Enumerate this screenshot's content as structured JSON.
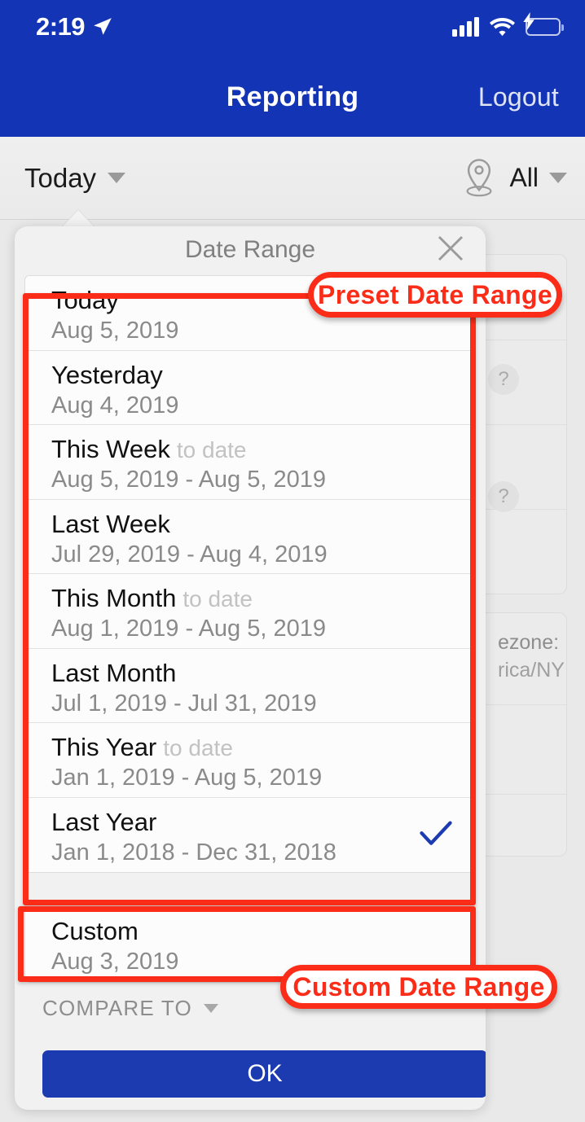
{
  "status_bar": {
    "time": "2:19",
    "location_icon": "location-arrow-icon",
    "signal_icon": "cellular-signal-icon",
    "wifi_icon": "wifi-icon",
    "battery_icon": "battery-charging-icon"
  },
  "nav": {
    "title": "Reporting",
    "logout_label": "Logout"
  },
  "filter_bar": {
    "date_filter_label": "Today",
    "location_filter_label": "All",
    "location_icon": "map-pin-icon",
    "chevron_icon": "chevron-down-icon"
  },
  "popover": {
    "title": "Date Range",
    "close_icon": "close-icon",
    "check_icon": "checkmark-icon",
    "compare_to_label": "COMPARE TO",
    "ok_label": "OK",
    "accent_color": "#1d3bb0",
    "presets": [
      {
        "title": "Today",
        "suffix": "",
        "range": "Aug 5, 2019",
        "selected": false
      },
      {
        "title": "Yesterday",
        "suffix": "",
        "range": "Aug 4, 2019",
        "selected": false
      },
      {
        "title": "This Week",
        "suffix": "to date",
        "range": "Aug 5, 2019 - Aug 5, 2019",
        "selected": false
      },
      {
        "title": "Last Week",
        "suffix": "",
        "range": "Jul 29, 2019 - Aug 4, 2019",
        "selected": false
      },
      {
        "title": "This Month",
        "suffix": "to date",
        "range": "Aug 1, 2019 - Aug 5, 2019",
        "selected": false
      },
      {
        "title": "Last Month",
        "suffix": "",
        "range": "Jul 1, 2019 - Jul 31, 2019",
        "selected": false
      },
      {
        "title": "This Year",
        "suffix": "to date",
        "range": "Jan 1, 2019 - Aug 5, 2019",
        "selected": false
      },
      {
        "title": "Last Year",
        "suffix": "",
        "range": "Jan 1, 2018 - Dec 31, 2018",
        "selected": true
      }
    ],
    "custom": {
      "title": "Custom",
      "suffix": "",
      "range": "Aug 3, 2019",
      "selected": false
    }
  },
  "background": {
    "help_badge_label": "?",
    "timezone_label": "ezone:",
    "timezone_value": "rica/NY"
  },
  "annotations": {
    "color": "#fb2d18",
    "preset_label": "Preset Date Range",
    "custom_label": "Custom Date Range"
  }
}
